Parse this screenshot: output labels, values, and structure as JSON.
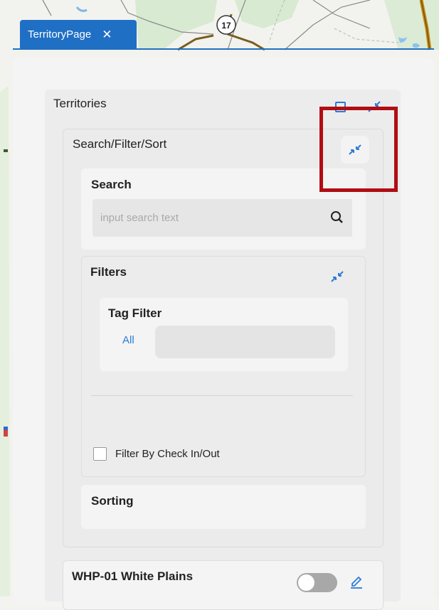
{
  "tab": {
    "label": "TerritoryPage",
    "close_icon": "✕"
  },
  "map": {
    "route_badge": "17"
  },
  "territories": {
    "title": "Territories",
    "search_filter_sort": {
      "title": "Search/Filter/Sort",
      "search": {
        "title": "Search",
        "placeholder": "input search text",
        "value": ""
      },
      "filters": {
        "title": "Filters",
        "tag_filter": {
          "title": "Tag Filter",
          "selected": "All"
        },
        "check_in_out": {
          "label": "Filter By Check In/Out",
          "checked": false
        }
      },
      "sorting": {
        "title": "Sorting"
      }
    },
    "items": [
      {
        "name": "WHP-01 White Plains",
        "toggle_on": false
      }
    ]
  },
  "colors": {
    "accent": "#2b7bd8",
    "tab_bg": "#1f6fc5",
    "highlight": "#b10d13"
  }
}
